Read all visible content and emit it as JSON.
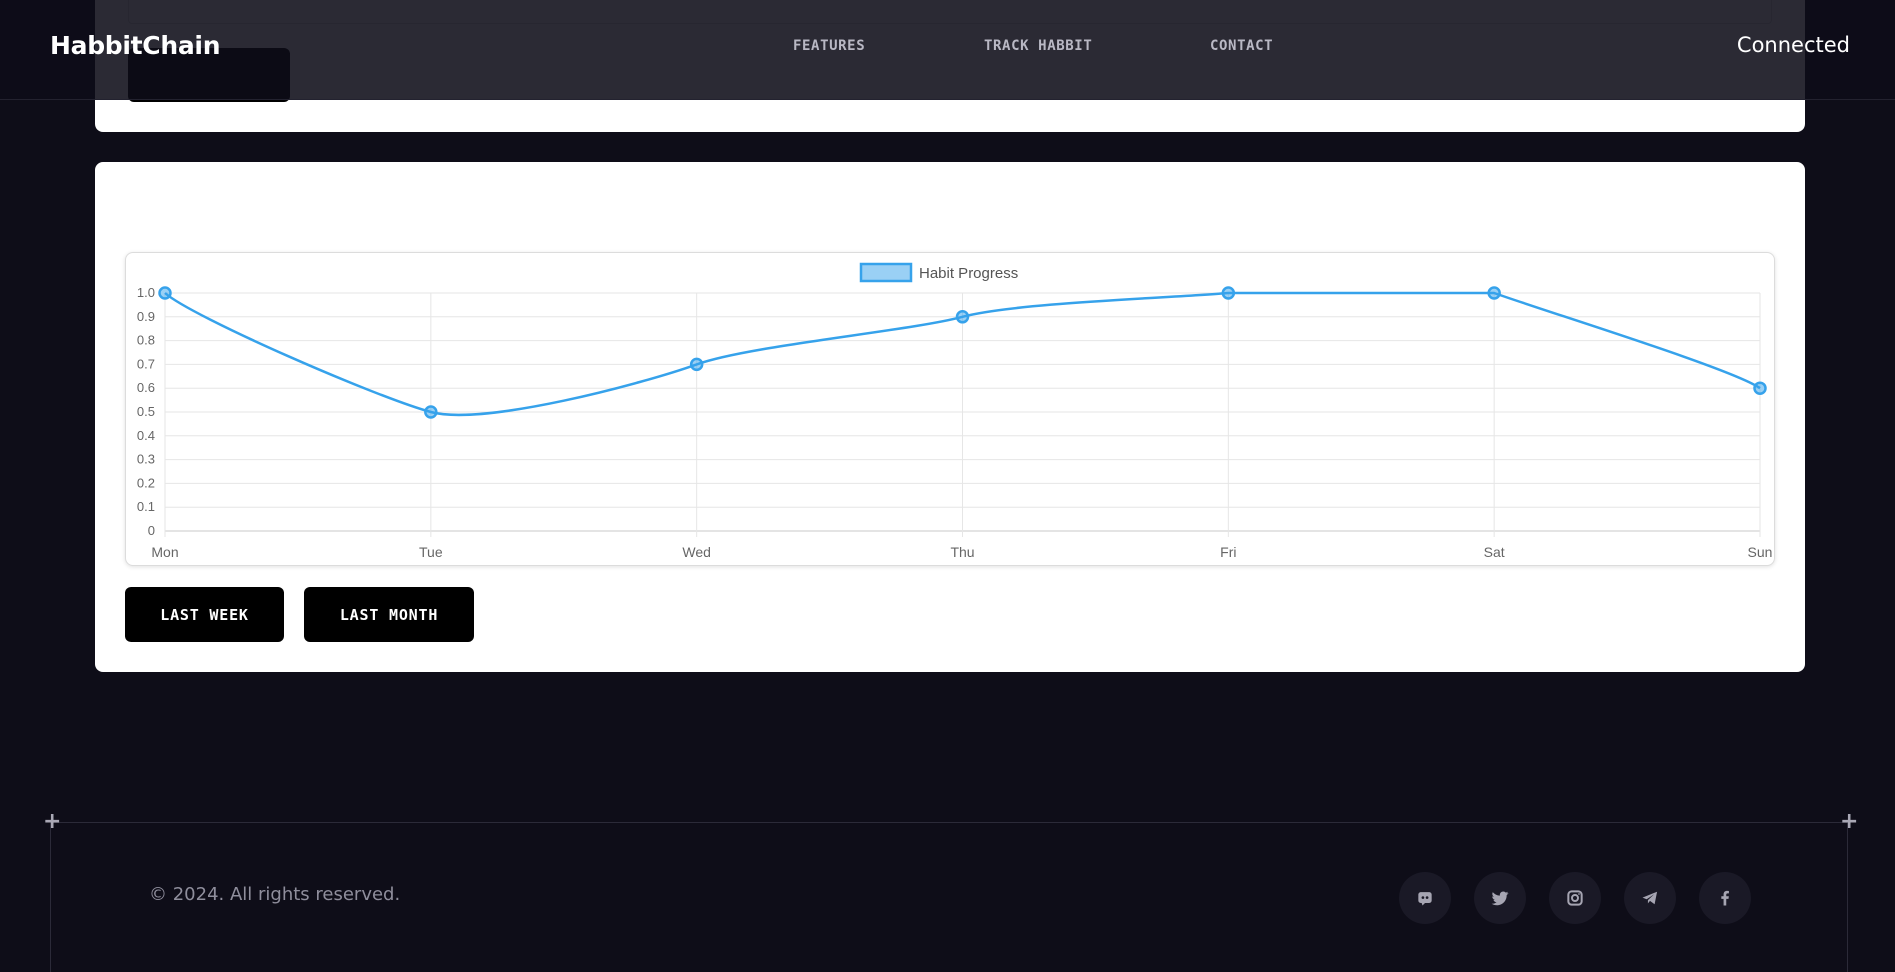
{
  "header": {
    "brand": "HabbitChain",
    "nav": [
      {
        "label": "FEATURES"
      },
      {
        "label": "TRACK HABBIT"
      },
      {
        "label": "CONTACT"
      }
    ],
    "wallet_status": "Connected"
  },
  "progress": {
    "range_buttons": [
      {
        "label": "LAST WEEK"
      },
      {
        "label": "LAST MONTH"
      }
    ]
  },
  "chart_data": {
    "type": "line",
    "title": "",
    "xlabel": "",
    "ylabel": "",
    "categories": [
      "Mon",
      "Tue",
      "Wed",
      "Thu",
      "Fri",
      "Sat",
      "Sun"
    ],
    "series": [
      {
        "name": "Habit Progress",
        "values": [
          1.0,
          0.5,
          0.7,
          0.9,
          1.0,
          1.0,
          0.6
        ],
        "color": "#36a2eb"
      }
    ],
    "yticks": [
      "0",
      "0.1",
      "0.2",
      "0.3",
      "0.4",
      "0.5",
      "0.6",
      "0.7",
      "0.8",
      "0.9",
      "1.0"
    ],
    "ylim": [
      0,
      1
    ],
    "grid": true,
    "legend": "top-center",
    "smooth": true
  },
  "footer": {
    "copyright": "© 2024. All rights reserved.",
    "social": [
      {
        "icon": "discord-icon"
      },
      {
        "icon": "twitter-icon"
      },
      {
        "icon": "instagram-icon"
      },
      {
        "icon": "telegram-icon"
      },
      {
        "icon": "facebook-icon"
      }
    ]
  }
}
